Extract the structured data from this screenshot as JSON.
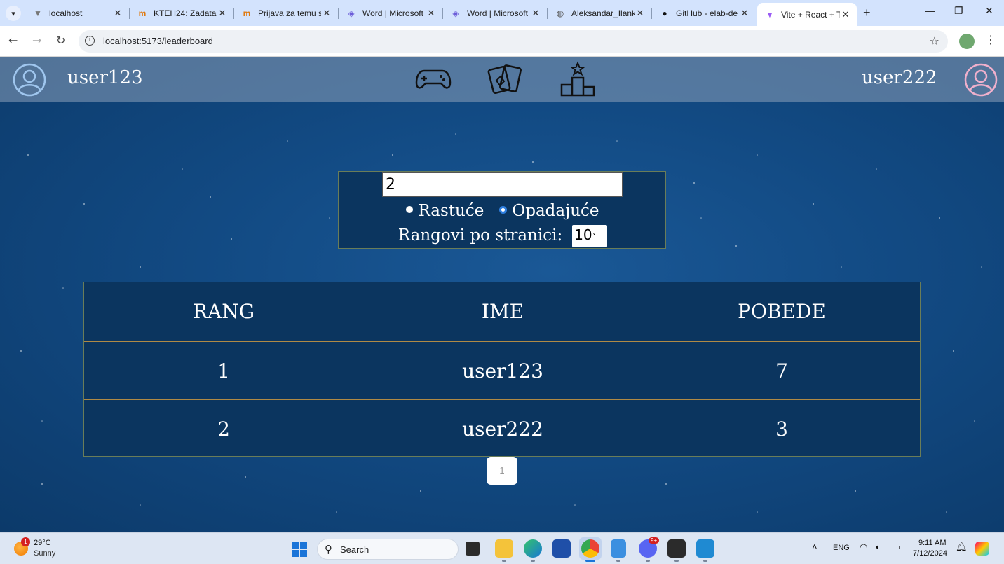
{
  "browser": {
    "tabs": [
      {
        "title": "localhost",
        "icon": "globe-icon"
      },
      {
        "title": "KTEH24: Zadatak",
        "icon": "moodle-icon"
      },
      {
        "title": "Prijava za temu s",
        "icon": "moodle-icon"
      },
      {
        "title": "Word | Microsoft",
        "icon": "copilot-icon"
      },
      {
        "title": "Word | Microsoft",
        "icon": "copilot-icon"
      },
      {
        "title": "Aleksandar_Ilank",
        "icon": "globe-icon"
      },
      {
        "title": "GitHub - elab-de",
        "icon": "github-icon"
      },
      {
        "title": "Vite + React + T",
        "icon": "vite-icon"
      }
    ],
    "active_tab_index": 7,
    "url": "localhost:5173/leaderboard"
  },
  "header": {
    "left_user": "user123",
    "right_user": "user222",
    "left_avatar_color": "#9fc6ee",
    "right_avatar_color": "#f0b0cc",
    "nav_icons": [
      "gamepad-icon",
      "cards-icon",
      "podium-icon"
    ]
  },
  "filters": {
    "search_value": "2",
    "sort_options": [
      {
        "label": "Rastuće",
        "checked": false
      },
      {
        "label": "Opadajuće",
        "checked": true
      }
    ],
    "per_page_label": "Rangovi po stranici:",
    "per_page_value": "10"
  },
  "leaderboard": {
    "columns": [
      "RANG",
      "IME",
      "POBEDE"
    ],
    "rows": [
      [
        "1",
        "user123",
        "7"
      ],
      [
        "2",
        "user222",
        "3"
      ]
    ]
  },
  "pagination": {
    "current_page": "1"
  },
  "taskbar": {
    "weather_temp": "29°C",
    "weather_condition": "Sunny",
    "weather_badge": "1",
    "search_label": "Search",
    "language": "ENG",
    "time": "9:11 AM",
    "date": "7/12/2024",
    "discord_badge": "9+"
  },
  "colors": {
    "page_background": "#124a83",
    "table_background": "#0b355f",
    "row_divider": "#b08a45",
    "radio_selected": "#2f7fe0"
  }
}
